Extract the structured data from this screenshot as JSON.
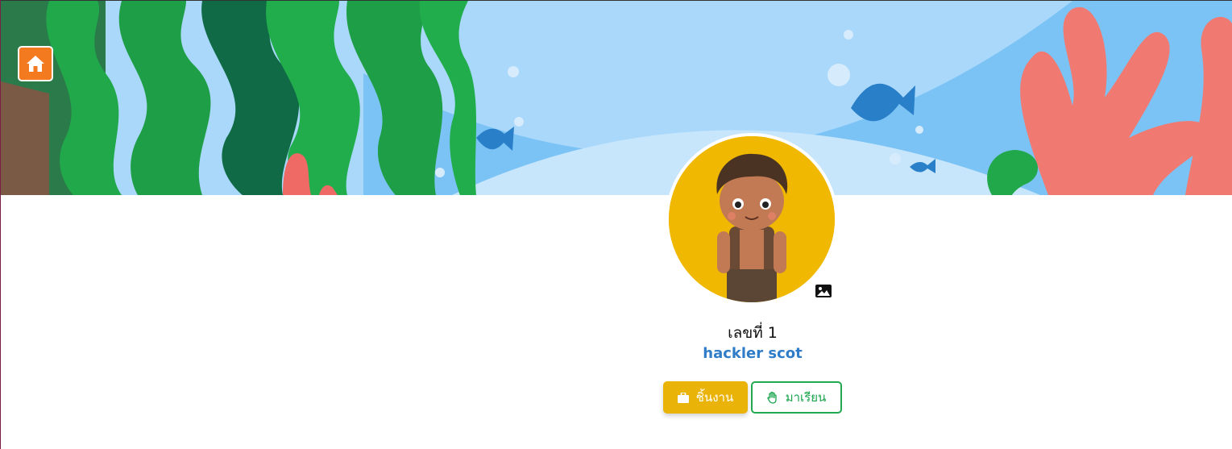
{
  "home_button": {
    "icon": "home-icon"
  },
  "profile": {
    "student_number": "เลขที่ 1",
    "student_name": "hackler scot",
    "avatar_bg": "#f0b800"
  },
  "actions": {
    "work_label": "ชิ้นงาน",
    "work_icon": "briefcase-icon",
    "attend_label": "มาเรียน",
    "attend_icon": "hand-icon"
  },
  "colors": {
    "home": "#f47a1f",
    "work": "#eab308",
    "attend": "#22a84f",
    "name": "#2f7cc9"
  }
}
